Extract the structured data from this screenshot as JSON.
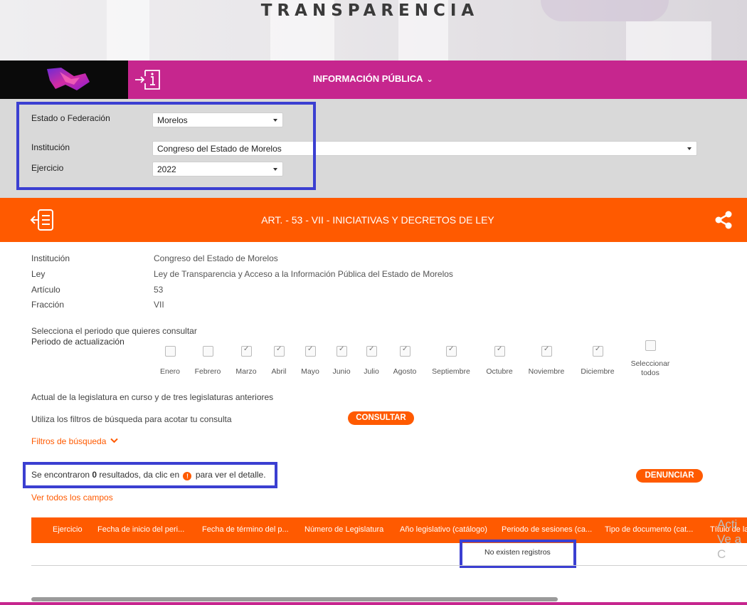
{
  "banner": {
    "title": "TRANSPARENCIA"
  },
  "nav": {
    "title": "INFORMACIÓN PÚBLICA",
    "chevron": "⌄"
  },
  "filters": {
    "estado_label": "Estado o Federación",
    "estado_value": "Morelos",
    "institucion_label": "Institución",
    "institucion_value": "Congreso del Estado de Morelos",
    "ejercicio_label": "Ejercicio",
    "ejercicio_value": "2022"
  },
  "article": {
    "title": "ART. - 53 - VII - INICIATIVAS Y DECRETOS DE LEY"
  },
  "details": {
    "institucion_label": "Institución",
    "institucion_value": "Congreso del Estado de Morelos",
    "ley_label": "Ley",
    "ley_value": "Ley de Transparencia y Acceso a la Información Pública del Estado de Morelos",
    "articulo_label": "Artículo",
    "articulo_value": "53",
    "fraccion_label": "Fracción",
    "fraccion_value": "VII"
  },
  "periodo": {
    "prompt": "Selecciona el periodo que quieres consultar",
    "label": "Periodo de actualización",
    "months": [
      {
        "label": "Enero",
        "checked": false
      },
      {
        "label": "Febrero",
        "checked": false
      },
      {
        "label": "Marzo",
        "checked": true
      },
      {
        "label": "Abril",
        "checked": true
      },
      {
        "label": "Mayo",
        "checked": true
      },
      {
        "label": "Junio",
        "checked": true
      },
      {
        "label": "Julio",
        "checked": true
      },
      {
        "label": "Agosto",
        "checked": true
      },
      {
        "label": "Septiembre",
        "checked": true
      },
      {
        "label": "Octubre",
        "checked": true
      },
      {
        "label": "Noviembre",
        "checked": true
      },
      {
        "label": "Diciembre",
        "checked": true
      }
    ],
    "select_all_1": "Seleccionar",
    "select_all_2": "todos"
  },
  "notes": {
    "legislatura": "Actual de la legislatura en curso y de tres legislaturas anteriores",
    "filtros_hint": "Utiliza los filtros de búsqueda para acotar tu consulta",
    "consultar": "CONSULTAR",
    "filtros_link": "Filtros de búsqueda",
    "results_prefix": "Se encontraron ",
    "results_count": "0",
    "results_mid": " resultados, da clic en ",
    "results_icon": "!",
    "results_suffix": " para ver el detalle.",
    "denunciar": "DENUNCIAR",
    "ver_todos": "Ver todos los campos"
  },
  "table": {
    "headers": [
      "Ejercicio",
      "Fecha de inicio del peri...",
      "Fecha de término del p...",
      "Número de Legislatura",
      "Año legislativo (catálogo)",
      "Periodo de sesiones (ca...",
      "Tipo de documento (cat...",
      "Título de la"
    ],
    "empty": "No existen registros"
  },
  "watermark": {
    "line1": "Acti",
    "line2": "Ve a C"
  },
  "colors": {
    "magenta": "#c6268e",
    "orange": "#ff5a00",
    "highlight": "#3b3fd1"
  }
}
